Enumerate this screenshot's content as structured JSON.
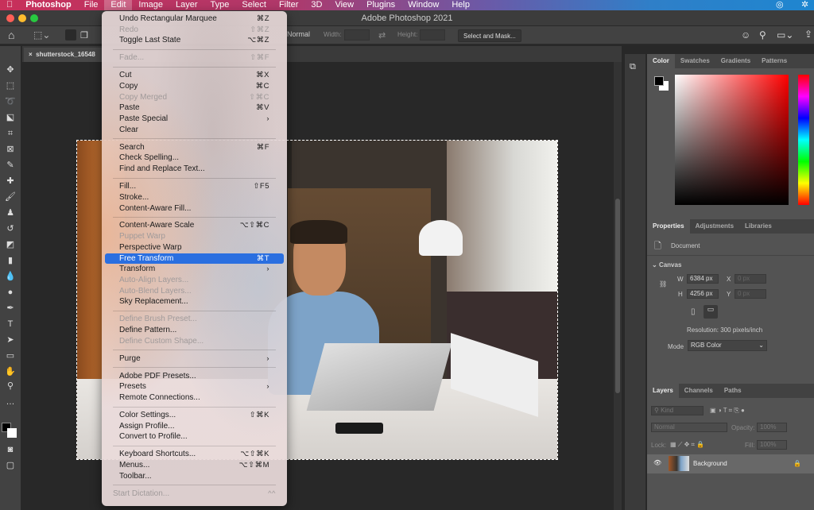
{
  "menubar": {
    "apple": "",
    "app": "Photoshop",
    "items": [
      "File",
      "Edit",
      "Image",
      "Layer",
      "Type",
      "Select",
      "Filter",
      "3D",
      "View",
      "Plugins",
      "Window",
      "Help"
    ]
  },
  "window": {
    "title": "Adobe Photoshop 2021"
  },
  "options": {
    "style_value": "Normal",
    "width_label": "Width:",
    "height_label": "Height:",
    "select_and_mask": "Select and Mask..."
  },
  "document_tab": {
    "close": "×",
    "name": "shutterstock_16548"
  },
  "edit_menu": [
    {
      "label": "Undo Rectangular Marquee",
      "shortcut": "⌘Z"
    },
    {
      "label": "Redo",
      "shortcut": "⇧⌘Z",
      "disabled": true
    },
    {
      "label": "Toggle Last State",
      "shortcut": "⌥⌘Z"
    },
    {
      "sep": true
    },
    {
      "label": "Fade...",
      "shortcut": "⇧⌘F",
      "disabled": true
    },
    {
      "sep": true
    },
    {
      "label": "Cut",
      "shortcut": "⌘X"
    },
    {
      "label": "Copy",
      "shortcut": "⌘C"
    },
    {
      "label": "Copy Merged",
      "shortcut": "⇧⌘C",
      "disabled": true
    },
    {
      "label": "Paste",
      "shortcut": "⌘V"
    },
    {
      "label": "Paste Special",
      "shortcut": "›"
    },
    {
      "label": "Clear",
      "shortcut": ""
    },
    {
      "sep": true
    },
    {
      "label": "Search",
      "shortcut": "⌘F"
    },
    {
      "label": "Check Spelling...",
      "shortcut": ""
    },
    {
      "label": "Find and Replace Text...",
      "shortcut": ""
    },
    {
      "sep": true
    },
    {
      "label": "Fill...",
      "shortcut": "⇧F5"
    },
    {
      "label": "Stroke...",
      "shortcut": ""
    },
    {
      "label": "Content-Aware Fill...",
      "shortcut": ""
    },
    {
      "sep": true
    },
    {
      "label": "Content-Aware Scale",
      "shortcut": "⌥⇧⌘C"
    },
    {
      "label": "Puppet Warp",
      "shortcut": "",
      "disabled": true
    },
    {
      "label": "Perspective Warp",
      "shortcut": ""
    },
    {
      "label": "Free Transform",
      "shortcut": "⌘T",
      "selected": true
    },
    {
      "label": "Transform",
      "shortcut": "›"
    },
    {
      "label": "Auto-Align Layers...",
      "shortcut": "",
      "disabled": true
    },
    {
      "label": "Auto-Blend Layers...",
      "shortcut": "",
      "disabled": true
    },
    {
      "label": "Sky Replacement...",
      "shortcut": ""
    },
    {
      "sep": true
    },
    {
      "label": "Define Brush Preset...",
      "shortcut": "",
      "disabled": true
    },
    {
      "label": "Define Pattern...",
      "shortcut": ""
    },
    {
      "label": "Define Custom Shape...",
      "shortcut": "",
      "disabled": true
    },
    {
      "sep": true
    },
    {
      "label": "Purge",
      "shortcut": "›"
    },
    {
      "sep": true
    },
    {
      "label": "Adobe PDF Presets...",
      "shortcut": ""
    },
    {
      "label": "Presets",
      "shortcut": "›"
    },
    {
      "label": "Remote Connections...",
      "shortcut": ""
    },
    {
      "sep": true
    },
    {
      "label": "Color Settings...",
      "shortcut": "⇧⌘K"
    },
    {
      "label": "Assign Profile...",
      "shortcut": ""
    },
    {
      "label": "Convert to Profile...",
      "shortcut": ""
    },
    {
      "sep": true
    },
    {
      "label": "Keyboard Shortcuts...",
      "shortcut": "⌥⇧⌘K"
    },
    {
      "label": "Menus...",
      "shortcut": "⌥⇧⌘M"
    },
    {
      "label": "Toolbar...",
      "shortcut": ""
    },
    {
      "sep": true
    },
    {
      "label": "Start Dictation...",
      "shortcut": "^^",
      "dim": true
    }
  ],
  "color_panel": {
    "tabs": [
      "Color",
      "Swatches",
      "Gradients",
      "Patterns"
    ],
    "foreground": "#000000",
    "background": "#ffffff",
    "hue_color": "#ff0000"
  },
  "properties_panel": {
    "tabs": [
      "Properties",
      "Adjustments",
      "Libraries"
    ],
    "document_label": "Document",
    "section": "Canvas",
    "w_label": "W",
    "w_value": "6384 px",
    "h_label": "H",
    "h_value": "4256 px",
    "x_label": "X",
    "x_value": "0 px",
    "y_label": "Y",
    "y_value": "0 px",
    "resolution": "Resolution: 300 pixels/inch",
    "mode_label": "Mode",
    "mode_value": "RGB Color"
  },
  "layers_panel": {
    "tabs": [
      "Layers",
      "Channels",
      "Paths"
    ],
    "filter_placeholder": "Kind",
    "blend_mode": "Normal",
    "opacity_label": "Opacity:",
    "opacity_value": "100%",
    "lock_label": "Lock:",
    "fill_label": "Fill:",
    "fill_value": "100%",
    "layers": [
      {
        "name": "Background",
        "visible": true,
        "locked": true
      }
    ]
  },
  "colors": {
    "accent": "#2a6fe0",
    "panel": "#535353"
  }
}
